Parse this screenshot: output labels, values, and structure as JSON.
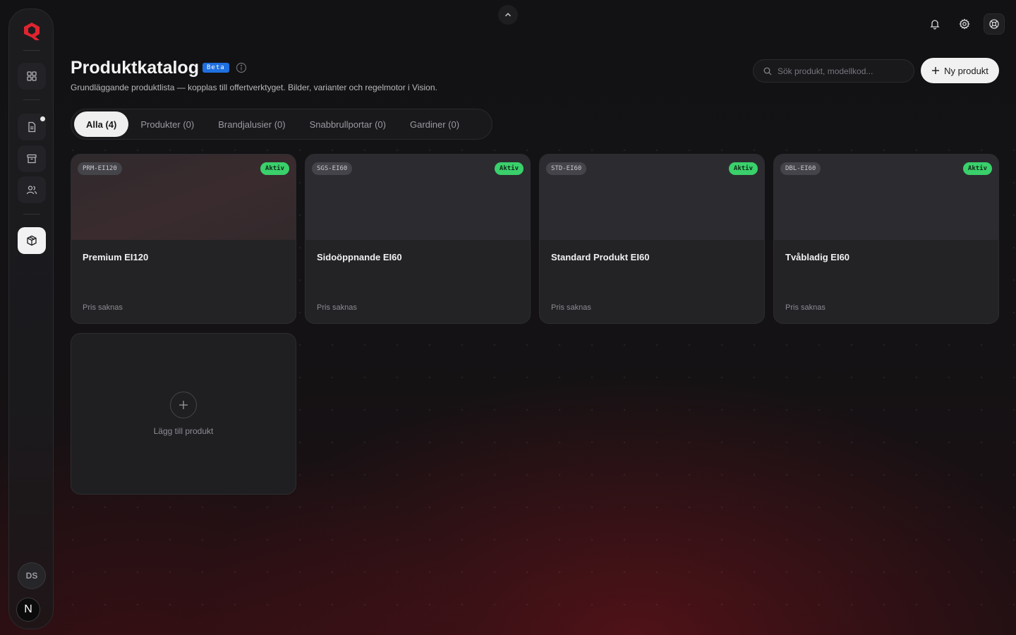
{
  "header": {
    "title": "Produktkatalog",
    "beta_badge": "Beta",
    "subtitle": "Grundläggande produktlista — kopplas till offertverktyget. Bilder, varianter och regelmotor i Vision."
  },
  "search": {
    "placeholder": "Sök produkt, modellkod..."
  },
  "new_button": {
    "label": "Ny produkt"
  },
  "tabs": [
    {
      "label": "Alla (4)",
      "active": true
    },
    {
      "label": "Produkter (0)"
    },
    {
      "label": "Brandjalusier (0)"
    },
    {
      "label": "Snabbrullportar (0)"
    },
    {
      "label": "Gardiner (0)"
    }
  ],
  "products": [
    {
      "code": "PRM-EI120",
      "status": "Aktiv",
      "name": "Premium EI120",
      "price": "Pris saknas"
    },
    {
      "code": "SGS-EI60",
      "status": "Aktiv",
      "name": "Sidoöppnande EI60",
      "price": "Pris saknas"
    },
    {
      "code": "STD-EI60",
      "status": "Aktiv",
      "name": "Standard Produkt EI60",
      "price": "Pris saknas"
    },
    {
      "code": "DBL-EI60",
      "status": "Aktiv",
      "name": "Tvåbladig EI60",
      "price": "Pris saknas"
    }
  ],
  "add_card": {
    "label": "Lägg till produkt"
  },
  "sidebar": {
    "items": [
      {
        "icon": "dashboard-icon"
      },
      {
        "icon": "document-icon"
      },
      {
        "icon": "archive-icon"
      },
      {
        "icon": "users-icon"
      },
      {
        "icon": "package-icon",
        "active": true
      }
    ],
    "avatar_initials": "DS",
    "bottom_badge": "N"
  },
  "colors": {
    "accent_red": "#e0242f",
    "status_green": "#3ad06b",
    "beta_blue": "#1f6fe0"
  }
}
